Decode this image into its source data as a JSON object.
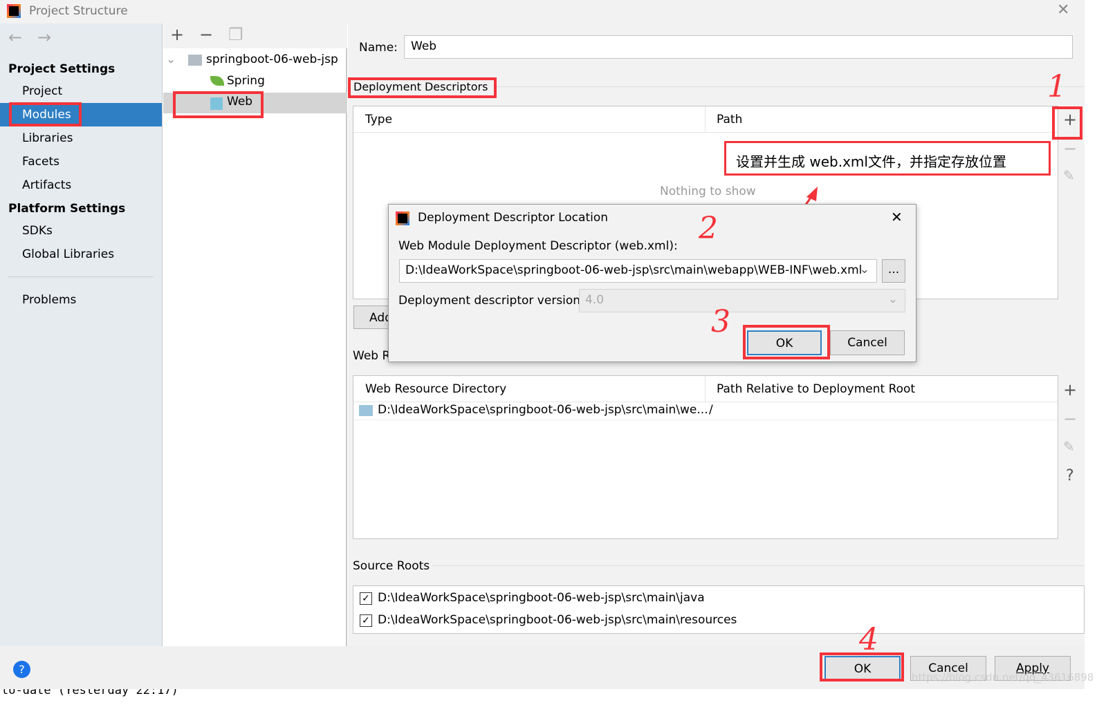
{
  "window": {
    "title": "Project Structure"
  },
  "sidebar": {
    "project_settings": "Project Settings",
    "items": [
      "Project",
      "Modules",
      "Libraries",
      "Facets",
      "Artifacts"
    ],
    "platform_settings": "Platform Settings",
    "platform_items": [
      "SDKs",
      "Global Libraries"
    ],
    "problems": "Problems"
  },
  "tree": {
    "root": "springboot-06-web-jsp",
    "children": [
      "Spring",
      "Web"
    ]
  },
  "main": {
    "name_label": "Name:",
    "name_value": "Web",
    "deployment_descriptors": "Deployment Descriptors",
    "col_type": "Type",
    "col_path": "Path",
    "empty": "Nothing to show",
    "add_button": "Add",
    "web_resource_label": "Web R",
    "wr_col1": "Web Resource Directory",
    "wr_col2": "Path Relative to Deployment Root",
    "wr_row_dir": "D:\\IdeaWorkSpace\\springboot-06-web-jsp\\src\\main\\we...",
    "wr_row_path": "/",
    "source_roots": "Source Roots",
    "roots": [
      "D:\\IdeaWorkSpace\\springboot-06-web-jsp\\src\\main\\java",
      "D:\\IdeaWorkSpace\\springboot-06-web-jsp\\src\\main\\resources"
    ]
  },
  "annotation": {
    "text": "设置并生成 web.xml文件，并指定存放位置",
    "steps": [
      "1",
      "2",
      "3",
      "4"
    ]
  },
  "dialog": {
    "title": "Deployment Descriptor Location",
    "label": "Web Module Deployment Descriptor (web.xml):",
    "path": "D:\\IdeaWorkSpace\\springboot-06-web-jsp\\src\\main\\webapp\\WEB-INF\\web.xml",
    "browse": "...",
    "version_label": "Deployment descriptor version",
    "version": "4.0",
    "ok": "OK",
    "cancel": "Cancel"
  },
  "footer": {
    "ok": "OK",
    "cancel": "Cancel",
    "apply": "Apply",
    "status": "to-date (Yesterday 22:17)",
    "watermark": "https://blog.csdn.net/qq_43616898"
  },
  "colors": {
    "accent": "#2f7fc4",
    "annotation": "#f4333a"
  }
}
